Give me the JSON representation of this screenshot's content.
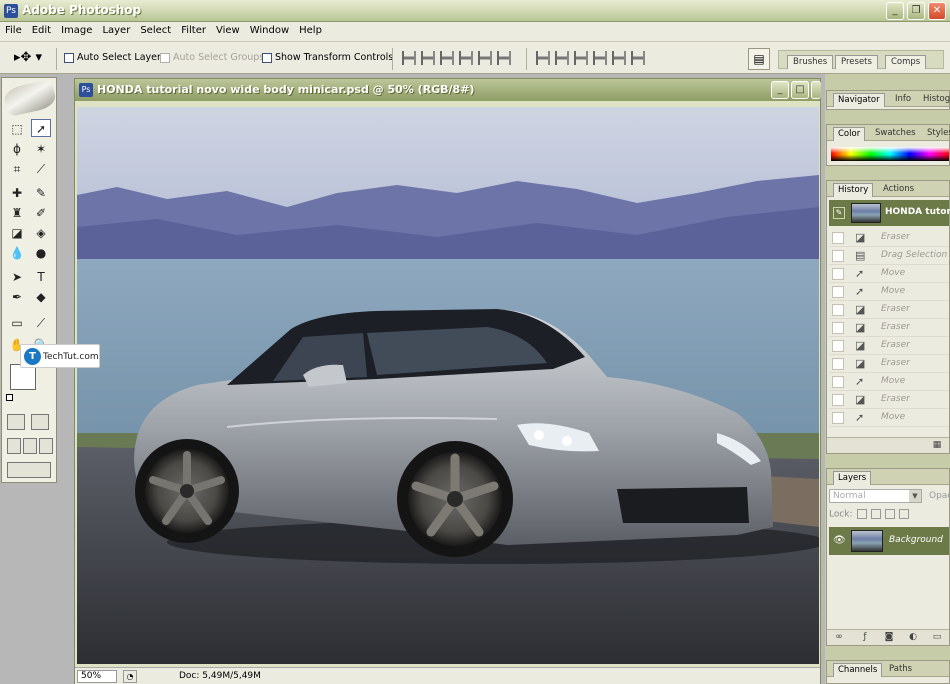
{
  "app": {
    "title": "Adobe Photoshop",
    "window_buttons": {
      "minimize": "_",
      "maximize": "❐",
      "close": "✕"
    }
  },
  "menu": [
    "File",
    "Edit",
    "Image",
    "Layer",
    "Select",
    "Filter",
    "View",
    "Window",
    "Help"
  ],
  "options": {
    "auto_select_layer": "Auto Select Layer",
    "auto_select_groups": "Auto Select Groups",
    "show_transform_controls": "Show Transform Controls",
    "palette_well_tabs": [
      "Brushes",
      "Presets",
      "Comps"
    ]
  },
  "document": {
    "title": "HONDA tutorial novo wide body minicar.psd @ 50% (RGB/8#)",
    "zoom": "50%",
    "doc_size": "Doc: 5,49M/5,49M"
  },
  "watermark": {
    "text": "TechTut.com"
  },
  "panels": {
    "navigator_tabs": [
      "Navigator",
      "Info",
      "Histog"
    ],
    "color_tabs": [
      "Color",
      "Swatches",
      "Styles"
    ],
    "history_tabs": [
      "History",
      "Actions"
    ],
    "history_snapshot": "HONDA tutori",
    "history_items": [
      "Eraser",
      "Drag Selection",
      "Move",
      "Move",
      "Eraser",
      "Eraser",
      "Eraser",
      "Eraser",
      "Move",
      "Eraser",
      "Move"
    ],
    "layers_tabs": [
      "Layers"
    ],
    "blend_mode": "Normal",
    "opacity_label": "Opac",
    "lock_label": "Lock:",
    "layer_name": "Background",
    "channels_tabs": [
      "Channels",
      "Paths"
    ]
  },
  "colors": {
    "accent_olive": "#6b7a47",
    "background_swatch": "#fbe9a2",
    "foreground_swatch": "#ffffff"
  }
}
